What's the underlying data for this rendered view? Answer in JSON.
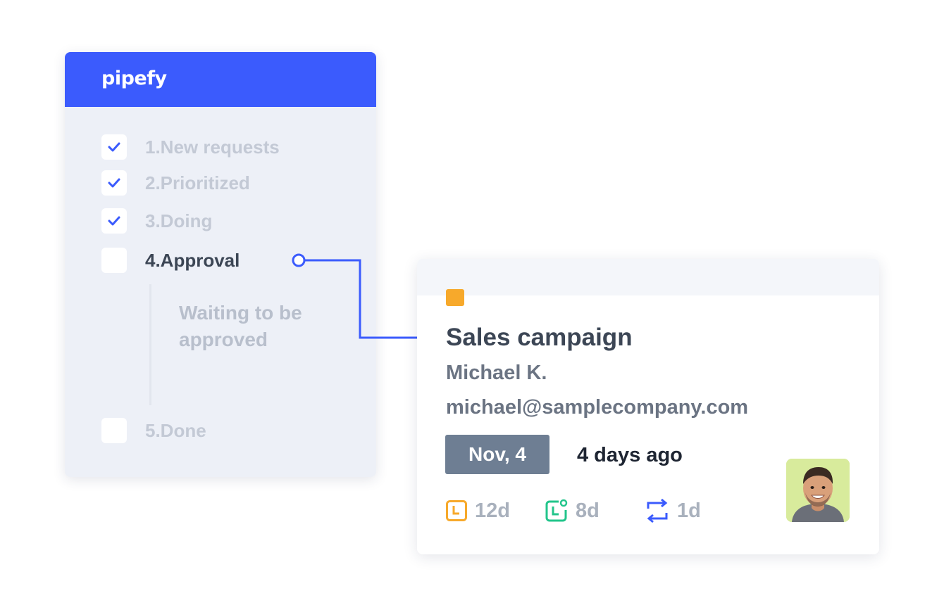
{
  "app": {
    "logo_text": "pipefy",
    "brand_color": "#3b5bfd"
  },
  "pipe": {
    "phases": [
      {
        "label": "1.New requests",
        "checked": true,
        "active": false
      },
      {
        "label": "2.Prioritized",
        "checked": true,
        "active": false
      },
      {
        "label": "3.Doing",
        "checked": true,
        "active": false
      },
      {
        "label": "4.Approval",
        "checked": false,
        "active": true
      },
      {
        "label": "5.Done",
        "checked": false,
        "active": false
      }
    ],
    "approval_substatus": "Waiting to be approved"
  },
  "card": {
    "label_color": "#f7a92b",
    "title": "Sales campaign",
    "assignee": "Michael K.",
    "email": "michael@samplecompany.com",
    "due_date": "Nov, 4",
    "relative_date": "4 days ago",
    "metrics": [
      {
        "icon": "clock-icon",
        "value": "12d",
        "color": "#f7a92b"
      },
      {
        "icon": "phase-time-icon",
        "value": "8d",
        "color": "#22c58b"
      },
      {
        "icon": "repeat-icon",
        "value": "1d",
        "color": "#3b5bfd"
      }
    ],
    "avatar_icon": "user-avatar"
  }
}
